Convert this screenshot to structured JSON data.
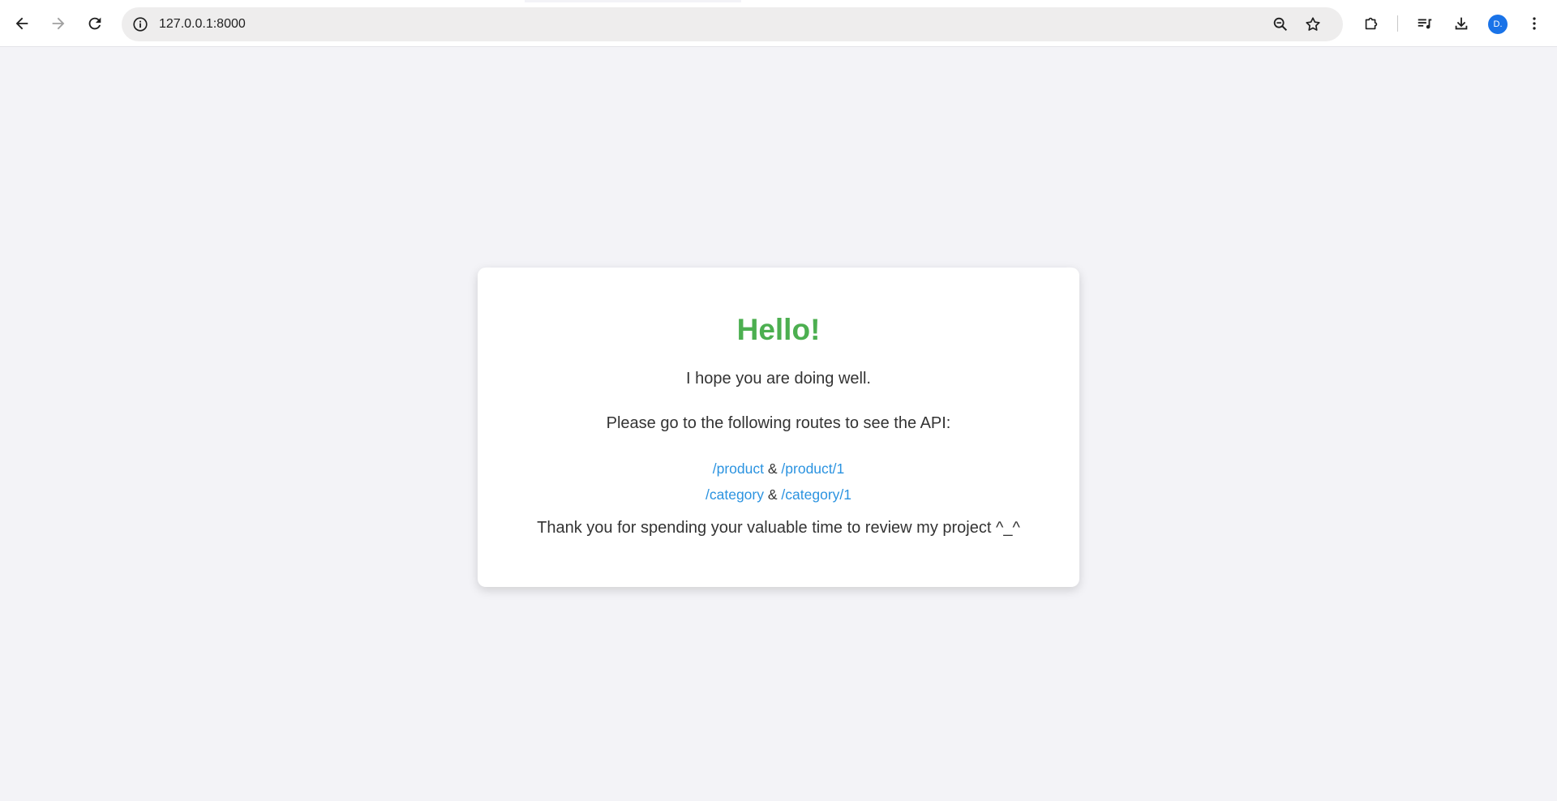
{
  "browser": {
    "url": "127.0.0.1:8000",
    "avatar_initial": "D."
  },
  "card": {
    "title": "Hello!",
    "greeting": "I hope you are doing well.",
    "instruction": "Please go to the following routes to see the API:",
    "routes": [
      {
        "first": "/product",
        "separator": "&",
        "second": "/product/1"
      },
      {
        "first": "/category",
        "separator": "&",
        "second": "/category/1"
      }
    ],
    "thanks": "Thank you for spending your valuable time to review my project ^_^"
  },
  "colors": {
    "title_green": "#4caf50",
    "link_blue": "#2b93e0",
    "page_bg": "#f3f3f7",
    "avatar_blue": "#1a73e8"
  }
}
